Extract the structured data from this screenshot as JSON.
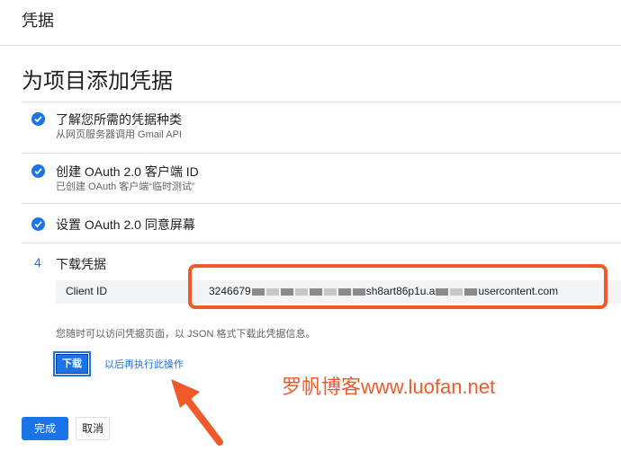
{
  "header": {
    "title": "凭据"
  },
  "page": {
    "title": "为项目添加凭据"
  },
  "steps": [
    {
      "label": "了解您所需的凭据种类",
      "sub": "从网页服务器调用 Gmail API"
    },
    {
      "label": "创建 OAuth 2.0 客户端 ID",
      "sub": "已创建 OAuth 客户端“临时测试”"
    },
    {
      "label": "设置 OAuth 2.0 同意屏幕",
      "sub": ""
    }
  ],
  "step4": {
    "number": "4",
    "label": "下载凭据",
    "credential_key": "Client ID",
    "credential_parts": [
      "3246679",
      "sh8art86p1u.a",
      "usercontent.com"
    ],
    "hint": "您随时可以访问凭据页面，以 JSON 格式下载此凭据信息。",
    "download_label": "下载",
    "later_link": "以后再执行此操作"
  },
  "footer": {
    "done_label": "完成",
    "cancel_label": "取消"
  },
  "watermark": "罗帆博客www.luofan.net",
  "colors": {
    "accent": "#1a73e8",
    "annotation": "#f05a2a"
  }
}
